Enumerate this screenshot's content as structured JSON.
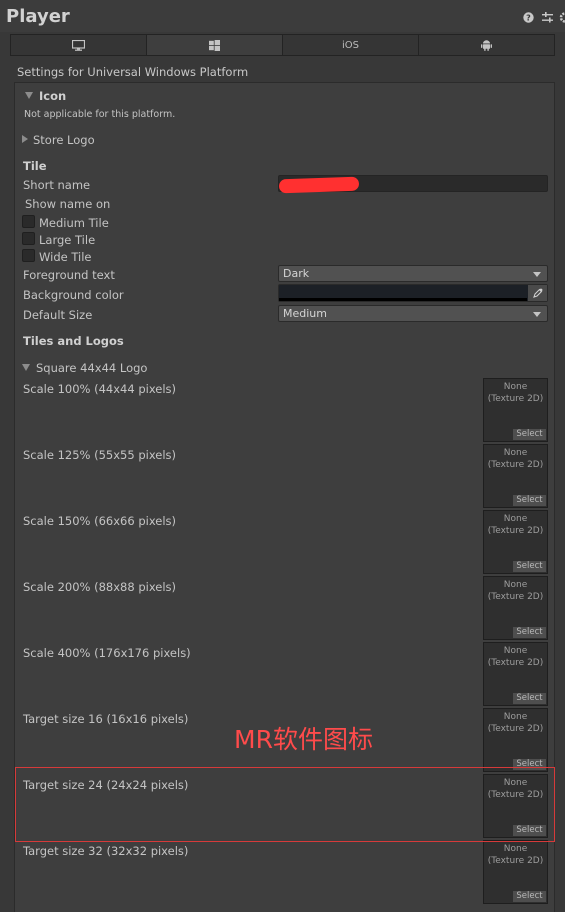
{
  "header": {
    "title": "Player",
    "icons": [
      "help-icon",
      "sliders-icon",
      "settings-icon"
    ]
  },
  "tabs": [
    {
      "icon": "desktop-icon",
      "label": ""
    },
    {
      "icon": "windows-icon",
      "label": ""
    },
    {
      "icon": "ios-icon",
      "label": "iOS"
    },
    {
      "icon": "android-icon",
      "label": ""
    }
  ],
  "settings_title": "Settings for Universal Windows Platform",
  "icon_section": {
    "header": "Icon",
    "note": "Not applicable for this platform."
  },
  "store_logo": "Store Logo",
  "tile": {
    "heading": "Tile",
    "short_name_label": "Short name",
    "short_name_value": "",
    "show_name_on": "Show name on",
    "checkboxes": [
      "Medium Tile",
      "Large Tile",
      "Wide Tile"
    ],
    "foreground_label": "Foreground text",
    "foreground_value": "Dark",
    "background_label": "Background color",
    "background_color": "#1c2026",
    "default_size_label": "Default Size",
    "default_size_value": "Medium"
  },
  "tiles_logos": {
    "heading": "Tiles and Logos",
    "subheader": "Square 44x44 Logo",
    "rows": [
      {
        "label": "Scale 100% (44x44 pixels)",
        "slot": "None",
        "slot_type": "(Texture 2D)",
        "select": "Select"
      },
      {
        "label": "Scale 125% (55x55 pixels)",
        "slot": "None",
        "slot_type": "(Texture 2D)",
        "select": "Select"
      },
      {
        "label": "Scale 150% (66x66 pixels)",
        "slot": "None",
        "slot_type": "(Texture 2D)",
        "select": "Select"
      },
      {
        "label": "Scale 200% (88x88 pixels)",
        "slot": "None",
        "slot_type": "(Texture 2D)",
        "select": "Select"
      },
      {
        "label": "Scale 400% (176x176 pixels)",
        "slot": "None",
        "slot_type": "(Texture 2D)",
        "select": "Select"
      },
      {
        "label": "Target size 16 (16x16 pixels)",
        "slot": "None",
        "slot_type": "(Texture 2D)",
        "select": "Select"
      },
      {
        "label": "Target size 24 (24x24 pixels)",
        "slot": "None",
        "slot_type": "(Texture 2D)",
        "select": "Select"
      },
      {
        "label": "Target size 32 (32x32 pixels)",
        "slot": "None",
        "slot_type": "(Texture 2D)",
        "select": "Select"
      }
    ]
  },
  "annotation": {
    "text": "MR软件图标",
    "color": "#ff4b4b"
  },
  "colors": {
    "background": "#383838",
    "panel": "#3e3e3e",
    "field": "#2a2a2a",
    "redaction": "#ff3030"
  }
}
